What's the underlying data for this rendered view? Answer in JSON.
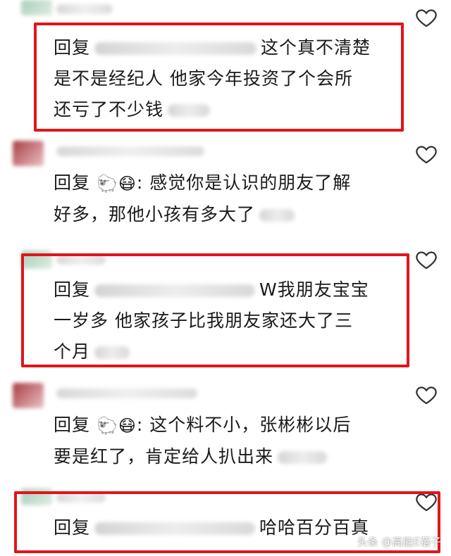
{
  "comments": [
    {
      "prefix": "回复",
      "line1_tail": "这个真不清楚",
      "line2": "是不是经纪人   他家今年投资了个会所",
      "line3": "还亏了不少钱"
    },
    {
      "prefix": "回复",
      "emoji1": "🐑",
      "emoji2": "😷",
      "line1_tail": ": 感觉你是认识的朋友了解",
      "line2": "好多，那他小孩有多大了"
    },
    {
      "prefix": "回复",
      "line1_tail": "W我朋友宝宝",
      "line2": "一岁多 他家孩子比我朋友家还大了三",
      "line3": "个月"
    },
    {
      "prefix": "回复",
      "emoji1": "🐑",
      "emoji2": "😷",
      "line1_tail": ": 这个料不小，张彬彬以后",
      "line2": "要是红了，肯定给人扒出来"
    },
    {
      "prefix": "回复",
      "line1_tail": "哈哈百分百真"
    }
  ],
  "watermark": "头条 @高能E蓓子",
  "icons": {
    "like": "heart-outline-icon"
  },
  "colors": {
    "highlight_box": "#e1151a"
  }
}
